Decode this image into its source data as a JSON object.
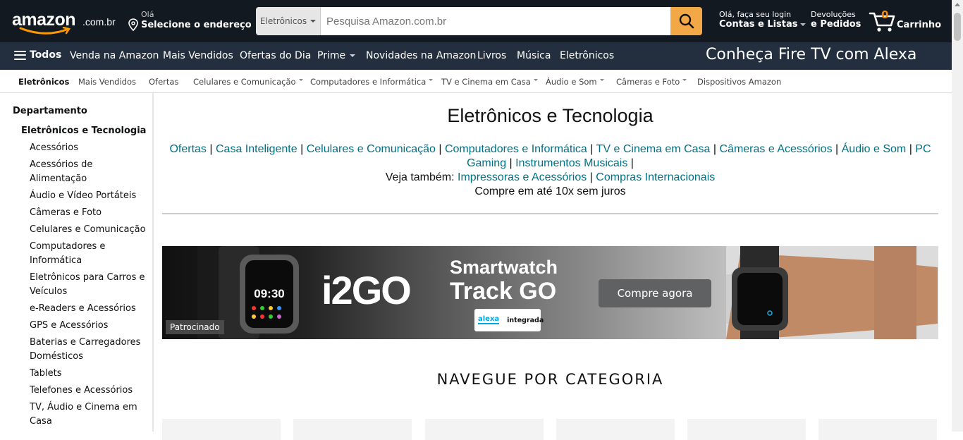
{
  "header": {
    "logo_word": "amazon",
    "logo_tld": ".com.br",
    "deliver_line1": "Olá",
    "deliver_line2": "Selecione o endereço",
    "search_category": "Eletrônicos",
    "search_placeholder": "Pesquisa Amazon.com.br",
    "account_line1": "Olá, faça seu login",
    "account_line2": "Contas e Listas",
    "returns_line1": "Devoluções",
    "returns_line2": "e Pedidos",
    "cart_count": "0",
    "cart_label": "Carrinho"
  },
  "mainnav": {
    "all": "Todos",
    "items": [
      "Venda na Amazon",
      "Mais Vendidos",
      "Ofertas do Dia",
      "Prime",
      "Novidades na Amazon",
      "Livros",
      "Música",
      "Eletrônicos"
    ],
    "promo": "Conheça Fire TV com Alexa"
  },
  "subnav": {
    "items": [
      "Eletrônicos",
      "Mais Vendidos",
      "Ofertas",
      "Celulares e Comunicação",
      "Computadores e Informática",
      "TV e Cinema em Casa",
      "Áudio e Som",
      "Câmeras e Foto",
      "Dispositivos Amazon"
    ]
  },
  "sidebar": {
    "heading": "Departamento",
    "current": "Eletrônicos e Tecnologia",
    "items": [
      "Acessórios",
      "Acessórios de Alimentação",
      "Áudio e Vídeo Portáteis",
      "Câmeras e Foto",
      "Celulares e Comunicação",
      "Computadores e Informática",
      "Eletrônicos para Carros e Veículos",
      "e-Readers e Acessórios",
      "GPS e Acessórios",
      "Baterias e Carregadores Domésticos",
      "Tablets",
      "Telefones e Acessórios",
      "TV, Áudio e Cinema em Casa"
    ]
  },
  "main": {
    "title": "Eletrônicos e Tecnologia",
    "links_row1": [
      "Ofertas",
      "Casa Inteligente",
      "Celulares e Comunicação",
      "Computadores e Informática",
      "TV e Cinema em Casa",
      "Câmeras e Acessórios",
      "Áudio e Som",
      "PC Gaming",
      "Instrumentos Musicais"
    ],
    "see_also_label": "Veja também:",
    "see_also": [
      "Impressoras e Acessórios",
      "Compras Internacionais"
    ],
    "installments": "Compre em até 10x sem juros",
    "banner": {
      "brand": "i2GO",
      "headline1": "Smartwatch",
      "headline2": "Track GO",
      "alexa_label": "alexa",
      "alexa_badge": "integrada",
      "cta": "Compre agora",
      "sponsored": "Patrocinado",
      "watch_time": "09:30"
    },
    "browse_heading": "NAVEGUE POR CATEGORIA"
  }
}
